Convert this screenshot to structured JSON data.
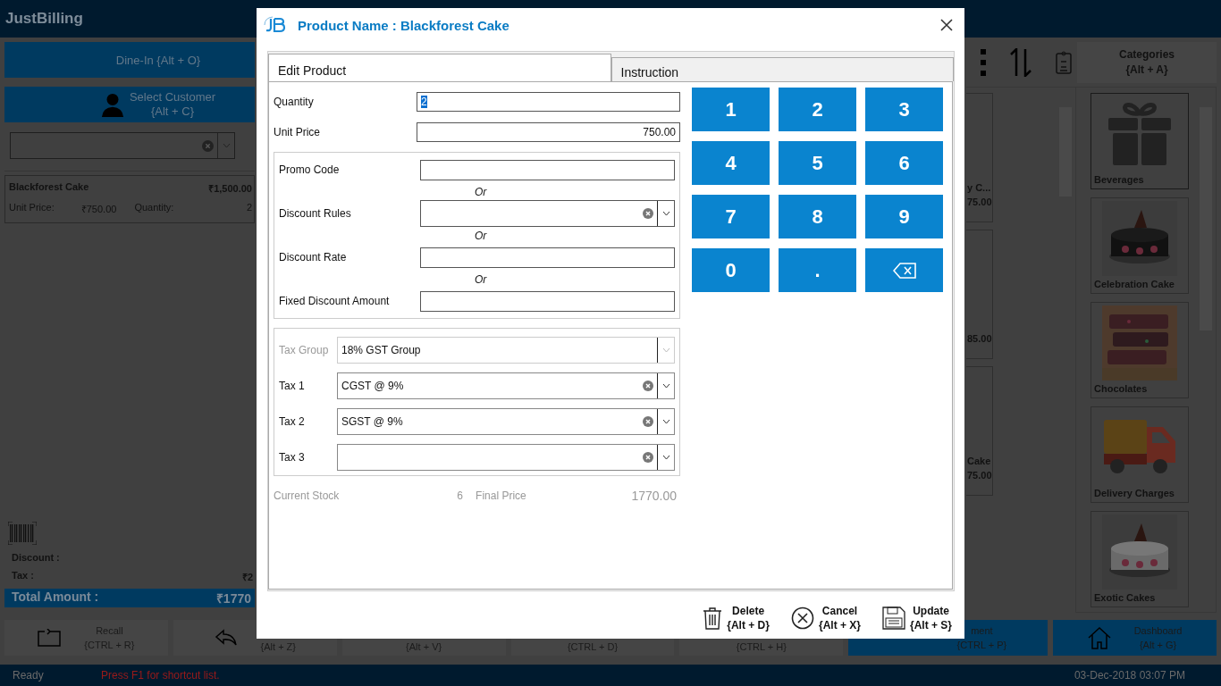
{
  "app": {
    "logo": "JustBilling",
    "dine_in": "Dine-In {Alt + O}",
    "customer": {
      "label": "Select Customer",
      "shortcut": "{Alt + C}"
    },
    "order_items": [
      {
        "name": "Blackforest Cake",
        "amount": "₹1,500.00",
        "unit_price_label": "Unit Price:",
        "unit_price": "₹750.00",
        "quantity_label": "Quantity:",
        "quantity": "2"
      }
    ],
    "summary": {
      "discount_label": "Discount :",
      "tax_label": "Tax :",
      "tax_value": "₹2",
      "total_label": "Total Amount :",
      "total_value": "₹1770"
    },
    "categories_button": {
      "label": "Categories",
      "shortcut": "{Alt + A}"
    },
    "product_tiles": [
      {
        "name": "y C...",
        "price": "75.00"
      },
      {
        "price": "85.00"
      },
      {
        "name": "Cake",
        "price": "75.00"
      }
    ],
    "categories": [
      {
        "name": "Beverages",
        "kind": "gift",
        "selected": true
      },
      {
        "name": "Celebration Cake",
        "kind": "picture",
        "selected": false
      },
      {
        "name": "Chocolates",
        "kind": "picture",
        "selected": false
      },
      {
        "name": "Delivery Charges",
        "kind": "truck",
        "selected": false
      },
      {
        "name": "Exotic Cakes",
        "kind": "picture",
        "selected": false
      }
    ],
    "toolbar_buttons": [
      {
        "label": "Recall",
        "shortcut": "{CTRL + R}",
        "kind": "recall"
      },
      {
        "shortcut": "{Alt + Z}",
        "kind": "undo"
      },
      {
        "shortcut": "{Alt + V}",
        "kind": "plain"
      },
      {
        "shortcut": "{CTRL + D}",
        "kind": "plain"
      },
      {
        "shortcut": "{CTRL + H}",
        "kind": "plain"
      },
      {
        "label": "ment",
        "shortcut": "{CTRL + P}",
        "kind": "payment"
      },
      {
        "label": "Dashboard",
        "shortcut": "{Alt + G}",
        "kind": "home"
      }
    ],
    "status_bar": {
      "status": "Ready",
      "hint": "Press F1 for shortcut list.",
      "datetime": "03-Dec-2018 03:07 PM"
    }
  },
  "dialog": {
    "title": "Product Name : Blackforest Cake",
    "tabs": [
      {
        "label": "Edit Product",
        "selected": true
      },
      {
        "label": "Instruction",
        "selected": false
      }
    ],
    "quantity": {
      "label": "Quantity",
      "value": "2",
      "value_selected": true
    },
    "unit_price": {
      "label": "Unit Price",
      "value": "750.00"
    },
    "discount_fields": [
      {
        "label": "Promo Code",
        "kind": "text"
      },
      {
        "label": "Discount Rules",
        "kind": "combo",
        "or_before": "Or"
      },
      {
        "label": "Discount Rate",
        "kind": "text",
        "or_before": "Or"
      },
      {
        "label": "Fixed Discount Amount",
        "kind": "text",
        "or_before": "Or"
      }
    ],
    "tax_fields": [
      {
        "label": "Tax Group",
        "value": "18% GST Group",
        "disabled": true
      },
      {
        "label": "Tax 1",
        "value": "CGST @ 9%",
        "disabled": false
      },
      {
        "label": "Tax 2",
        "value": "SGST @ 9%",
        "disabled": false
      },
      {
        "label": "Tax 3",
        "disabled": false
      }
    ],
    "stock": {
      "label": "Current Stock",
      "value": "6"
    },
    "final_price": {
      "label": "Final Price",
      "value": "1770.00"
    },
    "keypad": [
      {
        "label": "1"
      },
      {
        "label": "2"
      },
      {
        "label": "3"
      },
      {
        "label": "4"
      },
      {
        "label": "5"
      },
      {
        "label": "6"
      },
      {
        "label": "7"
      },
      {
        "label": "8"
      },
      {
        "label": "9"
      },
      {
        "label": "0"
      },
      {
        "label": "."
      },
      {
        "kind": "backspace"
      }
    ],
    "actions": [
      {
        "label": "Delete",
        "shortcut": "{Alt + D}",
        "kind": "delete"
      },
      {
        "label": "Cancel",
        "shortcut": "{Alt + X}",
        "kind": "cancel"
      },
      {
        "label": "Update",
        "shortcut": "{Alt + S}",
        "kind": "save"
      }
    ]
  }
}
